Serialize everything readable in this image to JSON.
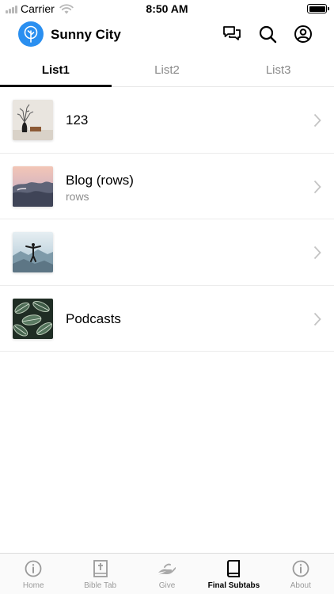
{
  "status_bar": {
    "carrier": "Carrier",
    "time": "8:50 AM"
  },
  "header": {
    "app_title": "Sunny City",
    "icons": [
      "chat-icon",
      "search-icon",
      "account-icon"
    ],
    "logo_color": "#2a8ff0"
  },
  "tabs": [
    {
      "label": "List1",
      "active": true
    },
    {
      "label": "List2",
      "active": false
    },
    {
      "label": "List3",
      "active": false
    }
  ],
  "list": [
    {
      "title": "123",
      "subtitle": "",
      "thumb": "vase-image"
    },
    {
      "title": "Blog (rows)",
      "subtitle": "rows",
      "thumb": "clouds-image"
    },
    {
      "title": "",
      "subtitle": "",
      "thumb": "person-mountain-image"
    },
    {
      "title": "Podcasts",
      "subtitle": "",
      "thumb": "leaves-image"
    }
  ],
  "tab_bar": [
    {
      "label": "Home",
      "icon": "info-icon",
      "active": false
    },
    {
      "label": "Bible Tab",
      "icon": "bible-icon",
      "active": false
    },
    {
      "label": "Give",
      "icon": "give-hand-icon",
      "active": false
    },
    {
      "label": "Final Subtabs",
      "icon": "book-icon",
      "active": true
    },
    {
      "label": "About",
      "icon": "info-icon",
      "active": false
    }
  ]
}
